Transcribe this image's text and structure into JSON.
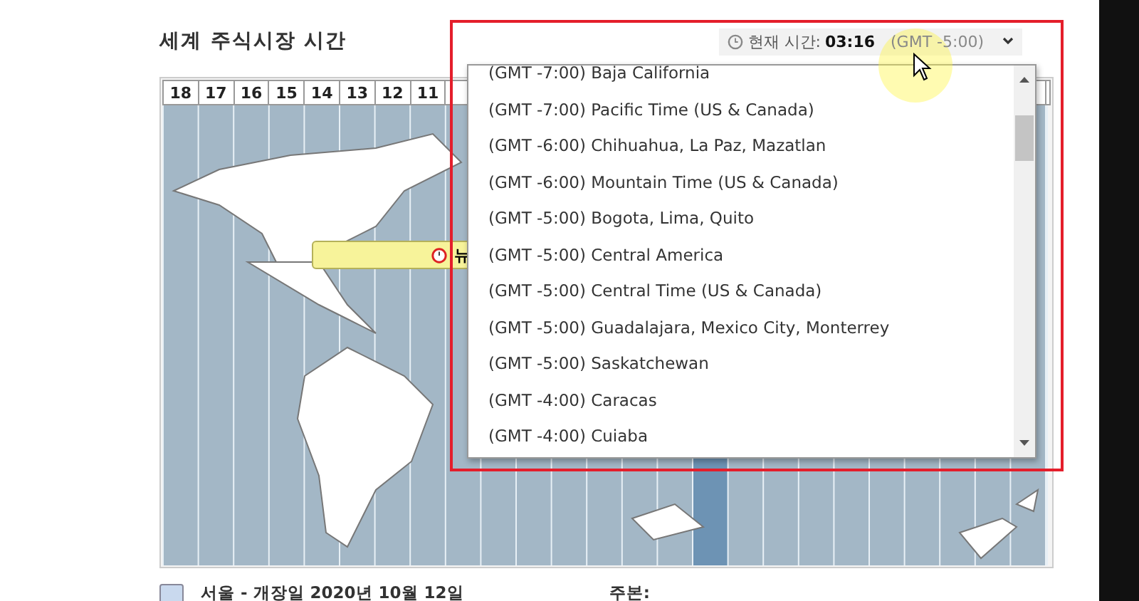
{
  "title": "세계 주식시장 시간",
  "clock": {
    "label": "현재 시간:",
    "time": "03:16",
    "zone": "(GMT -5:00)",
    "expanded": true
  },
  "hours": [
    "18",
    "17",
    "16",
    "15",
    "14",
    "13",
    "12",
    "11"
  ],
  "city_label": {
    "text": "뉴"
  },
  "timezone_options": [
    "(GMT -7:00) Baja California",
    "(GMT -7:00) Pacific Time (US & Canada)",
    "(GMT -6:00) Chihuahua, La Paz, Mazatlan",
    "(GMT -6:00) Mountain Time (US & Canada)",
    "(GMT -5:00) Bogota, Lima, Quito",
    "(GMT -5:00) Central America",
    "(GMT -5:00) Central Time (US & Canada)",
    "(GMT -5:00) Guadalajara, Mexico City, Monterrey",
    "(GMT -5:00) Saskatchewan",
    "(GMT -4:00) Caracas",
    "(GMT -4:00) Cuiaba"
  ],
  "legend": [
    {
      "text": "서울 - 개장일 2020년 10월 12일",
      "color": "#c9d9ee"
    },
    {
      "text": "주본:"
    }
  ]
}
